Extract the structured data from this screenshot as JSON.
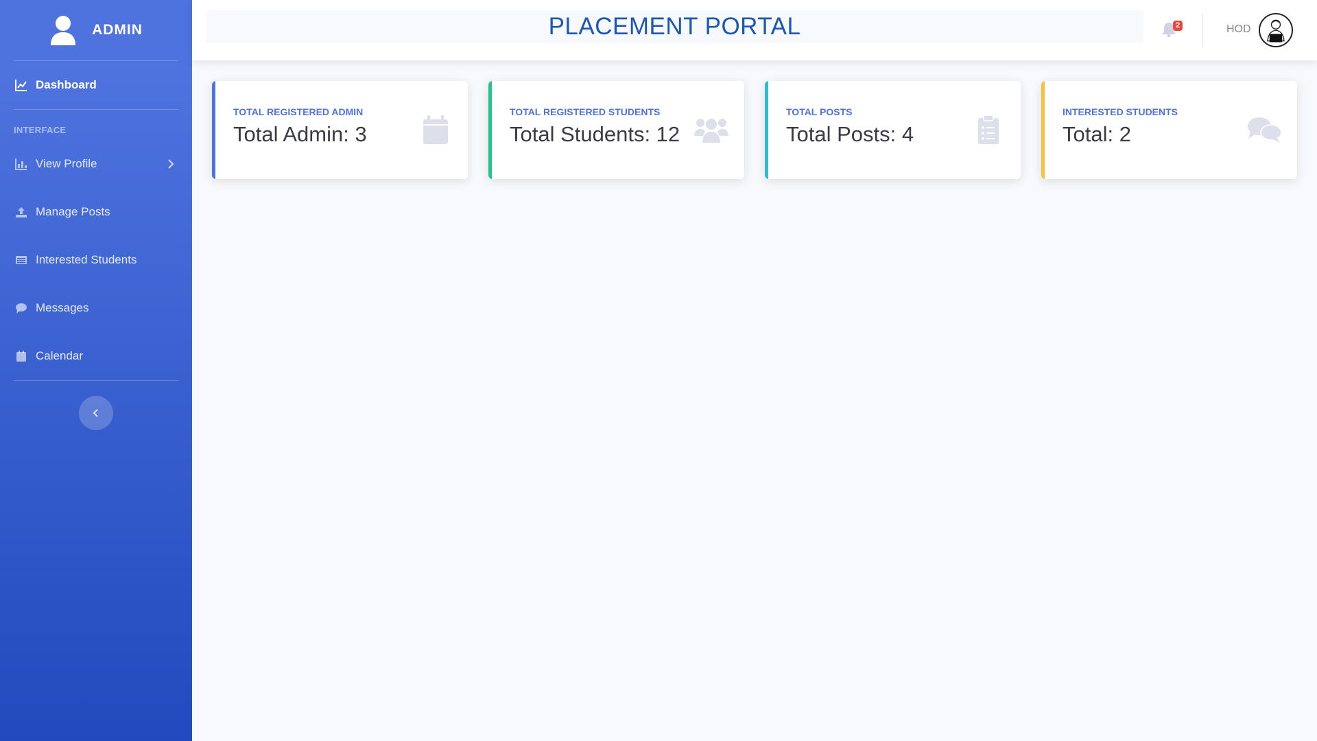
{
  "sidebar": {
    "brand": "ADMIN",
    "interface_heading": "INTERFACE",
    "items": [
      {
        "label": "Dashboard",
        "icon": "chart-line-icon"
      },
      {
        "label": "View Profile",
        "icon": "chart-bar-icon"
      },
      {
        "label": "Manage Posts",
        "icon": "upload-icon"
      },
      {
        "label": "Interested Students",
        "icon": "list-icon"
      },
      {
        "label": "Messages",
        "icon": "comment-icon"
      },
      {
        "label": "Calendar",
        "icon": "calendar-icon"
      }
    ]
  },
  "topbar": {
    "title": "PLACEMENT PORTAL",
    "notification_count": "2",
    "user_name": "HOD"
  },
  "cards": [
    {
      "label": "TOTAL REGISTERED ADMIN",
      "value": "Total Admin: 3",
      "accent": "#4e73df",
      "icon": "calendar-icon"
    },
    {
      "label": "TOTAL REGISTERED STUDENTS",
      "value": "Total Students: 12",
      "accent": "#1cc88a",
      "icon": "users-icon"
    },
    {
      "label": "TOTAL POSTS",
      "value": "Total Posts: 4",
      "accent": "#36b9cc",
      "icon": "clipboard-list-icon"
    },
    {
      "label": "INTERESTED STUDENTS",
      "value": "Total: 2",
      "accent": "#f6c23e",
      "icon": "comments-icon"
    }
  ],
  "colors": {
    "primary": "#4e73df",
    "card_label": "#4e73df",
    "icon_muted": "#dddfeb"
  }
}
